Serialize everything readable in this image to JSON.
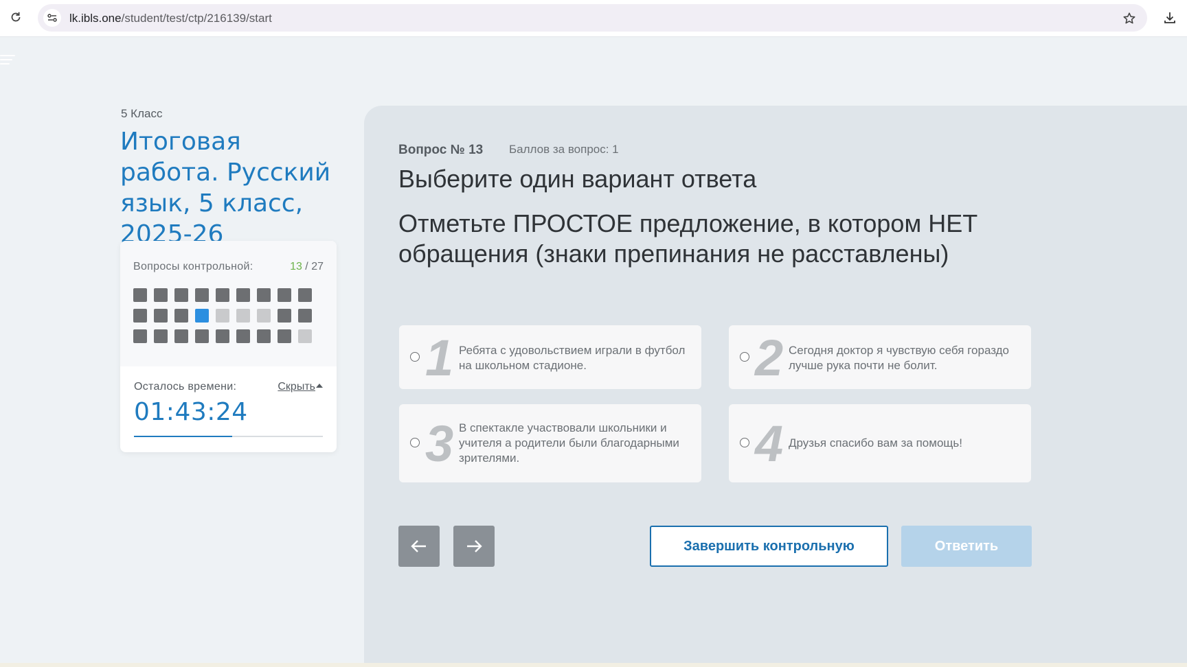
{
  "browser": {
    "url_host": "lk.ibls.one",
    "url_path": "/student/test/ctp/216139/start",
    "icons": [
      "reload-icon",
      "site-info-icon",
      "star-icon",
      "download-icon"
    ]
  },
  "sidebar": {
    "grade": "5 Класс",
    "title": "Итоговая работа. Русский язык, 5 класс, 2025-26",
    "questions_label": "Вопросы контрольной:",
    "current_question": "13",
    "separator": " / ",
    "total_questions": "27",
    "question_states": [
      "done",
      "done",
      "done",
      "done",
      "done",
      "done",
      "done",
      "done",
      "done",
      "done",
      "done",
      "done",
      "current",
      "empty",
      "empty",
      "empty",
      "done",
      "done",
      "done",
      "done",
      "done",
      "done",
      "done",
      "done",
      "done",
      "done",
      "empty"
    ],
    "time_label": "Осталось времени:",
    "hide_label": "Скрыть",
    "timer": "01:43:24",
    "time_remaining_fraction": 0.52
  },
  "question": {
    "number_label": "Вопрос № 13",
    "points_label": "Баллов за вопрос: 1",
    "instruction": "Выберите один вариант ответа",
    "text": "Отметьте ПРОСТОЕ предложение, в котором НЕТ обращения (знаки препинания не расставлены)",
    "options": [
      {
        "num": "1",
        "text": "Ребята с удовольствием играли в футбол на школьном стадионе."
      },
      {
        "num": "2",
        "text": "Сегодня доктор я чувствую себя гораздо лучше рука почти не болит."
      },
      {
        "num": "3",
        "text": "В спектакле участвовали школьники и учителя а родители были благодарными зрителями."
      },
      {
        "num": "4",
        "text": "Друзья спасибо вам за помощь!"
      }
    ]
  },
  "actions": {
    "prev_icon": "arrow-left-icon",
    "next_icon": "arrow-right-icon",
    "finish_label": "Завершить контрольную",
    "answer_label": "Ответить"
  },
  "colors": {
    "accent": "#1f7bbf",
    "done": "#6d6f72",
    "current": "#2c8fe0",
    "empty": "#c9cacc",
    "count_highlight": "#6db34a",
    "answer_disabled": "#b5d3ea"
  }
}
